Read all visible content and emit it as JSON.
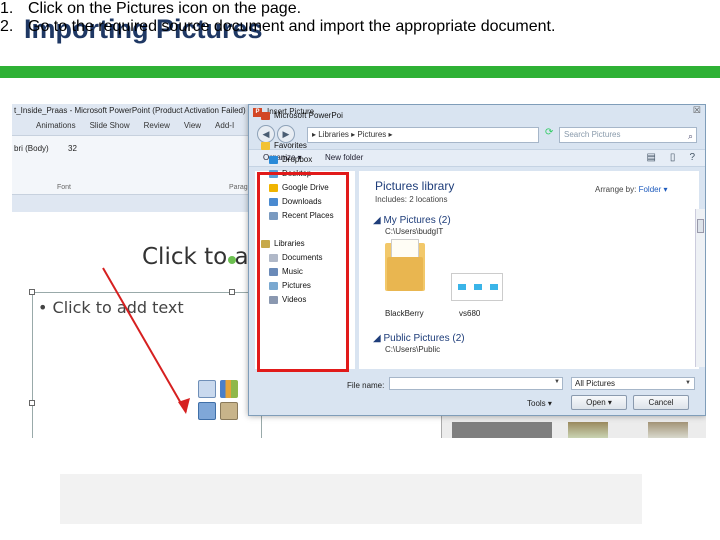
{
  "slide": {
    "title": "Importing Pictures",
    "steps": [
      {
        "num": "1.",
        "text": "Click on the Pictures icon on  the page."
      },
      {
        "num": "2.",
        "text": "Go to the required source document and import the appropriate document."
      }
    ]
  },
  "powerpoint": {
    "window_title": "t_Inside_Praas - Microsoft PowerPoint (Product Activation Failed)",
    "tabs": [
      "Animations",
      "Slide Show",
      "Review",
      "View",
      "Add-I"
    ],
    "font_name": "bri (Body)",
    "font_size": "32",
    "group_font": "Font",
    "group_paragraph": "Parag",
    "title_placeholder": "Click to ad",
    "content_bullet": "•",
    "content_placeholder": "Click to add text"
  },
  "dialog": {
    "title": "Insert Picture",
    "close_glyph": "☒",
    "address": "▸ Libraries ▸ Pictures ▸",
    "search_placeholder": "Search Pictures",
    "toolbar": {
      "organize": "Organize ▾",
      "new_folder": "New folder"
    },
    "nav_items": [
      {
        "label": "Microsoft PowerPoi",
        "color": "#d24726"
      },
      {
        "label": "Favorites",
        "color": "#f2c233"
      },
      {
        "label": "Dropbox",
        "color": "#2a8ad8"
      },
      {
        "label": "Desktop",
        "color": "#5aa0d8"
      },
      {
        "label": "Google Drive",
        "color": "#f0b400"
      },
      {
        "label": "Downloads",
        "color": "#4a8ad0"
      },
      {
        "label": "Recent Places",
        "color": "#7a9ac0"
      },
      {
        "label": "Libraries",
        "color": "#c7a94a"
      },
      {
        "label": "Documents",
        "color": "#b0b8c8"
      },
      {
        "label": "Music",
        "color": "#6a8ab8"
      },
      {
        "label": "Pictures",
        "color": "#7aa8d0"
      },
      {
        "label": "Videos",
        "color": "#8a98b0"
      }
    ],
    "library_title": "Pictures library",
    "library_includes": "Includes: 2 locations",
    "arrange_label": "Arrange by:",
    "arrange_value": "Folder ▾",
    "section1_title": "◢ My Pictures (2)",
    "section1_path": "C:\\Users\\budgIT",
    "section2_title": "◢ Public Pictures (2)",
    "section2_path": "C:\\Users\\Public",
    "file1": "BlackBerry",
    "file2": "vs680",
    "file_name_label": "File name:",
    "file_name_value": "",
    "filter_value": "All Pictures",
    "tools_label": "Tools ▾",
    "open_label": "Open  ▾",
    "cancel_label": "Cancel"
  }
}
